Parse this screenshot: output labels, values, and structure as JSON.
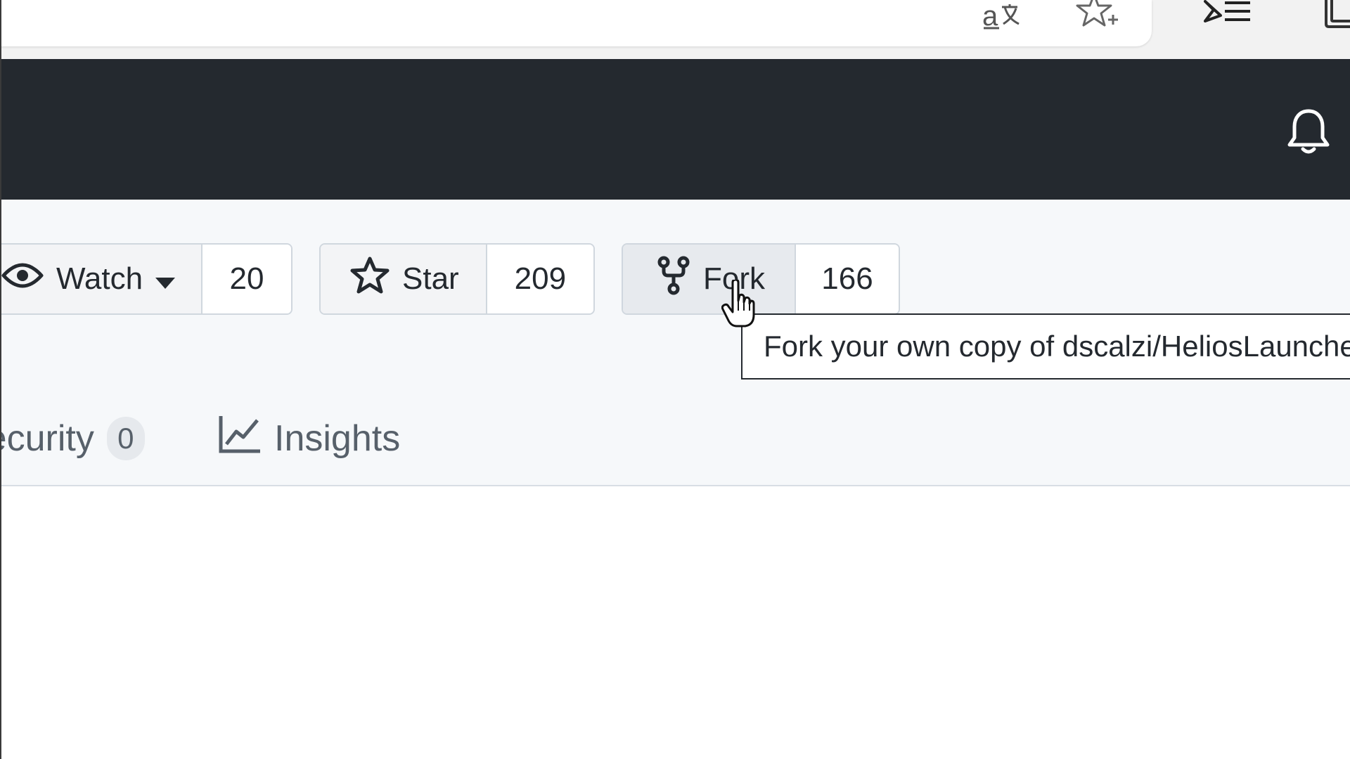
{
  "browser": {
    "toolbar_icons": [
      "translate-icon",
      "add-favorite-icon",
      "reading-list-icon",
      "collections-icon"
    ]
  },
  "header": {
    "notification_icon": "bell-icon"
  },
  "repo_actions": {
    "watch": {
      "label": "Watch",
      "count": "20",
      "icon": "eye-icon",
      "caret": "caret-down-icon"
    },
    "star": {
      "label": "Star",
      "count": "209",
      "icon": "star-icon"
    },
    "fork": {
      "label": "Fork",
      "count": "166",
      "icon": "repo-forked-icon"
    }
  },
  "tooltip": {
    "text": "Fork your own copy of dscalzi/HeliosLauncher"
  },
  "tabs": {
    "security": {
      "label": "Security",
      "count": "0"
    },
    "insights": {
      "label": "Insights",
      "icon": "graph-icon"
    }
  },
  "colors": {
    "header_bg": "#24292f",
    "repo_bg": "#f6f8fa",
    "border": "#d0d7de",
    "text": "#24292f",
    "muted": "#57606a"
  }
}
